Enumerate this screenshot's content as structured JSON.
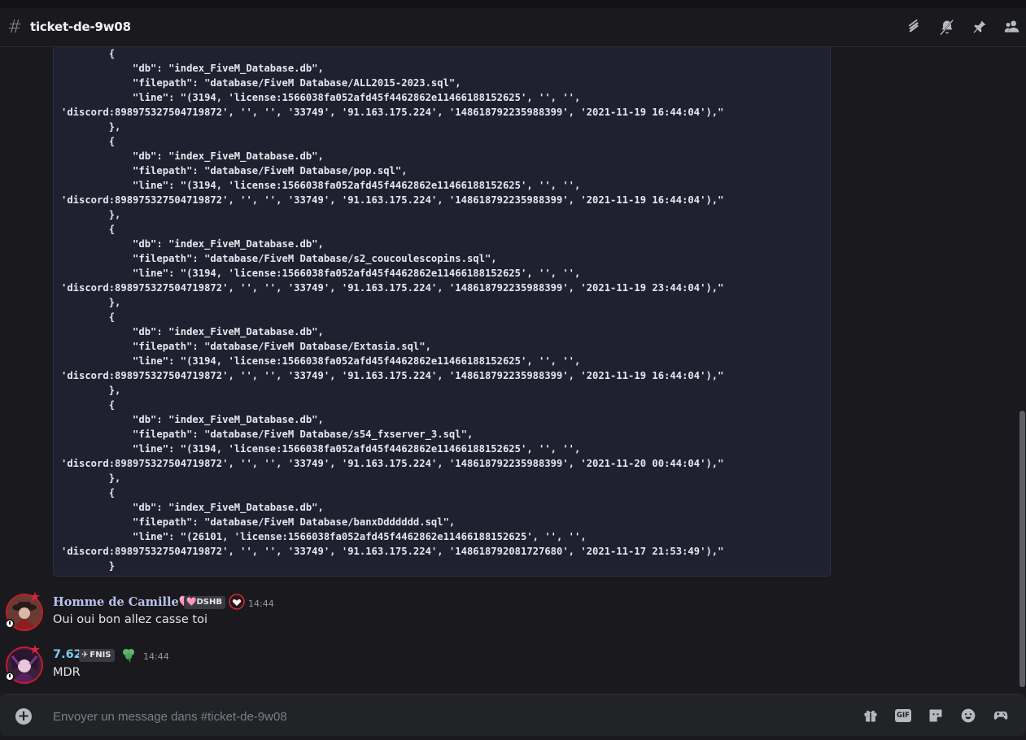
{
  "channel": {
    "name": "ticket-de-9w08"
  },
  "header_icons": [
    "threads-icon",
    "notification-muted-icon",
    "pin-icon",
    "members-icon"
  ],
  "code_block": {
    "lines": [
      "        {",
      "            \"db\": \"index_FiveM_Database.db\",",
      "            \"filepath\": \"database/FiveM Database/ALL2015-2023.sql\",",
      "            \"line\": \"(3194, 'license:1566038fa052afd45f4462862e11466188152625', '', '',",
      "'discord:898975327504719872', '', '', '33749', '91.163.175.224', '148618792235988399', '2021-11-19 16:44:04'),\"",
      "        },",
      "        {",
      "            \"db\": \"index_FiveM_Database.db\",",
      "            \"filepath\": \"database/FiveM Database/pop.sql\",",
      "            \"line\": \"(3194, 'license:1566038fa052afd45f4462862e11466188152625', '', '',",
      "'discord:898975327504719872', '', '', '33749', '91.163.175.224', '148618792235988399', '2021-11-19 16:44:04'),\"",
      "        },",
      "        {",
      "            \"db\": \"index_FiveM_Database.db\",",
      "            \"filepath\": \"database/FiveM Database/s2_coucoulescopins.sql\",",
      "            \"line\": \"(3194, 'license:1566038fa052afd45f4462862e11466188152625', '', '',",
      "'discord:898975327504719872', '', '', '33749', '91.163.175.224', '148618792235988399', '2021-11-19 23:44:04'),\"",
      "        },",
      "        {",
      "            \"db\": \"index_FiveM_Database.db\",",
      "            \"filepath\": \"database/FiveM Database/Extasia.sql\",",
      "            \"line\": \"(3194, 'license:1566038fa052afd45f4462862e11466188152625', '', '',",
      "'discord:898975327504719872', '', '', '33749', '91.163.175.224', '148618792235988399', '2021-11-19 16:44:04'),\"",
      "        },",
      "        {",
      "            \"db\": \"index_FiveM_Database.db\",",
      "            \"filepath\": \"database/FiveM Database/s54_fxserver_3.sql\",",
      "            \"line\": \"(3194, 'license:1566038fa052afd45f4462862e11466188152625', '', '',",
      "'discord:898975327504719872', '', '', '33749', '91.163.175.224', '148618792235988399', '2021-11-20 00:44:04'),\"",
      "        },",
      "        {",
      "            \"db\": \"index_FiveM_Database.db\",",
      "            \"filepath\": \"database/FiveM Database/banxDdddddd.sql\",",
      "            \"line\": \"(26101, 'license:1566038fa052afd45f4462862e11466188152625', '', '',",
      "'discord:898975327504719872', '', '', '33749', '91.163.175.224', '148618792081727680', '2021-11-17 21:53:49'),\"",
      "        }"
    ]
  },
  "messages": [
    {
      "username": "Homme de Camille",
      "username_suffix": "🩷",
      "tag": "DSHB",
      "tag_prefix": "🩷",
      "timestamp": "14:44",
      "text": "Oui oui bon allez casse toi",
      "name_color": "#b9c1f0"
    },
    {
      "username": "7.62",
      "tag": "FNIS",
      "tag_prefix": "✈",
      "timestamp": "14:44",
      "text": "MDR",
      "name_color": "#7bc8f2"
    }
  ],
  "composer": {
    "placeholder": "Envoyer un message dans #ticket-de-9w08",
    "gif_label": "GIF"
  },
  "composer_icons": [
    "gift-icon",
    "gif-icon",
    "sticker-icon",
    "emoji-icon",
    "activities-icon"
  ],
  "colors": {
    "background": "#1a1a1e",
    "code_background": "#1f2030",
    "accent_pink": "#f47fff"
  }
}
